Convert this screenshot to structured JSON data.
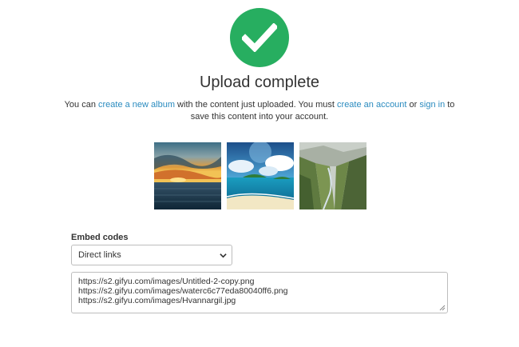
{
  "status": {
    "icon": "checkmark-icon",
    "color": "#27ae60",
    "title": "Upload complete"
  },
  "message": {
    "part1": "You can ",
    "link_album": "create a new album",
    "part2": " with the content just uploaded. You must ",
    "link_account": "create an account",
    "part3": " or ",
    "link_signin": "sign in",
    "part4": " to save this content into your account."
  },
  "thumbnails": [
    {
      "icon": "sunset-sea-thumbnail"
    },
    {
      "icon": "tropical-beach-thumbnail"
    },
    {
      "icon": "mountain-valley-thumbnail"
    }
  ],
  "embed": {
    "label": "Embed codes",
    "selected": "Direct links",
    "links": [
      "https://s2.gifyu.com/images/Untitled-2-copy.png",
      "https://s2.gifyu.com/images/waterc6c77eda80040ff6.png",
      "https://s2.gifyu.com/images/Hvannargil.jpg"
    ]
  },
  "colors": {
    "accent_link": "#2a8bbf",
    "success": "#27ae60"
  }
}
